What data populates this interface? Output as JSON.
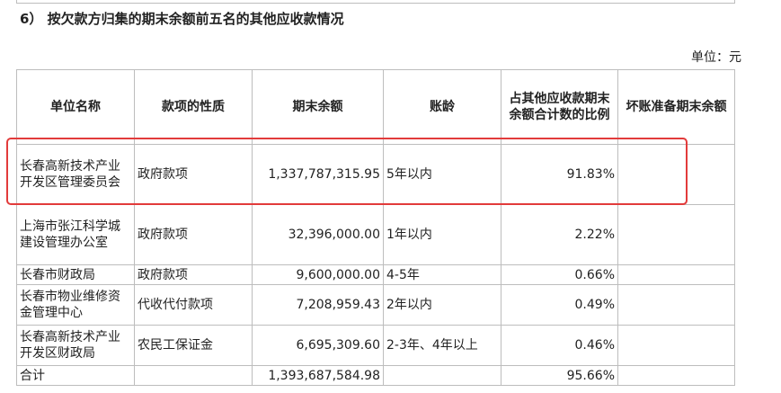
{
  "section_title": "6） 按欠款方归集的期末余额前五名的其他应收款情况",
  "unit_label": "单位：元",
  "table": {
    "headers": [
      "单位名称",
      "款项的性质",
      "期末余额",
      "账龄",
      "占其他应收款期末余额合计数的比例",
      "坏账准备期末余额"
    ],
    "rows": [
      {
        "name": "长春高新技术产业开发区管理委员会",
        "nature": "政府款项",
        "balance": "1,337,787,315.95",
        "aging": "5年以内",
        "ratio": "91.83%",
        "bad_debt": ""
      },
      {
        "name": "上海市张江科学城建设管理办公室",
        "nature": "政府款项",
        "balance": "32,396,000.00",
        "aging": "1年以内",
        "ratio": "2.22%",
        "bad_debt": ""
      },
      {
        "name": "长春市财政局",
        "nature": "政府款项",
        "balance": "9,600,000.00",
        "aging": "4-5年",
        "ratio": "0.66%",
        "bad_debt": ""
      },
      {
        "name": "长春市物业维修资金管理中心",
        "nature": "代收代付款项",
        "balance": "7,208,959.43",
        "aging": "2年以内",
        "ratio": "0.49%",
        "bad_debt": ""
      },
      {
        "name": "长春高新技术产业开发区财政局",
        "nature": "农民工保证金",
        "balance": "6,695,309.60",
        "aging": "2-3年、4年以上",
        "ratio": "0.46%",
        "bad_debt": ""
      }
    ],
    "total": {
      "label": "合计",
      "balance": "1,393,687,584.98",
      "ratio": "95.66%"
    }
  },
  "highlight_color": "#e23b3b"
}
